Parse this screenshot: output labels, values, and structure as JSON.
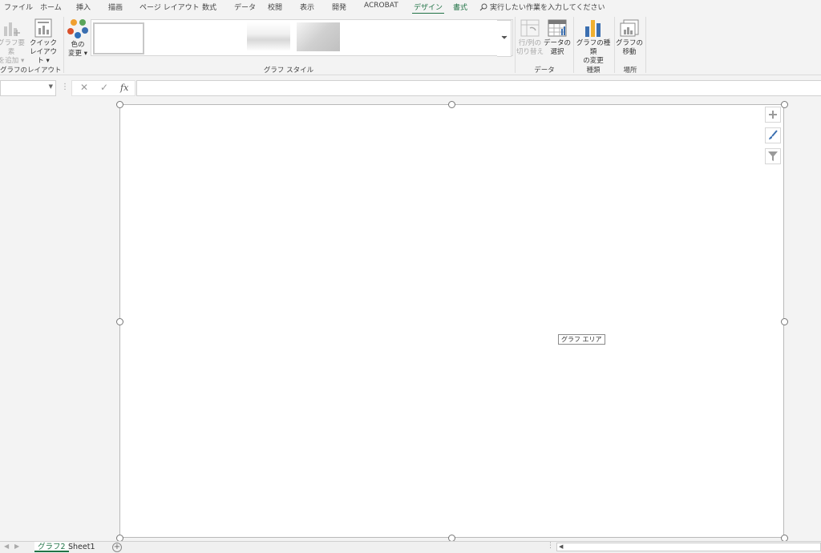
{
  "ribbon_tabs": [
    "ファイル",
    "ホーム",
    "挿入",
    "描画",
    "ページ レイアウト",
    "数式",
    "データ",
    "校閲",
    "表示",
    "開発",
    "ACROBAT",
    "デザイン",
    "書式"
  ],
  "active_tab": "デザイン",
  "tell_me": "実行したい作業を入力してください",
  "ribbon": {
    "add_element": {
      "line1": "グラフ要素",
      "line2": "を追加 ▾"
    },
    "quick_layout": {
      "line1": "クイック",
      "line2": "レイアウト ▾"
    },
    "change_colors": {
      "line1": "色の",
      "line2": "変更 ▾"
    },
    "switch_row_col": {
      "line1": "行/列の",
      "line2": "切り替え"
    },
    "select_data": {
      "line1": "データの",
      "line2": "選択"
    },
    "change_type": {
      "line1": "グラフの種類",
      "line2": "の変更"
    },
    "move_chart": {
      "line1": "グラフの",
      "line2": "移動"
    },
    "groups": {
      "layout": "グラフのレイアウト",
      "styles": "グラフ スタイル",
      "data": "データ",
      "type": "種類",
      "location": "場所"
    }
  },
  "formula_bar": {
    "name_box": "",
    "cancel": "✕",
    "enter": "✓",
    "fx": "fx",
    "formula": ""
  },
  "chart": {
    "tooltip": "グラフ エリア",
    "side_buttons": [
      "plus-icon",
      "brush-icon",
      "filter-icon"
    ]
  },
  "sheet_tabs": [
    "グラフ2",
    "Sheet1"
  ],
  "active_sheet": "グラフ2",
  "colors": {
    "accent": "#217346"
  }
}
